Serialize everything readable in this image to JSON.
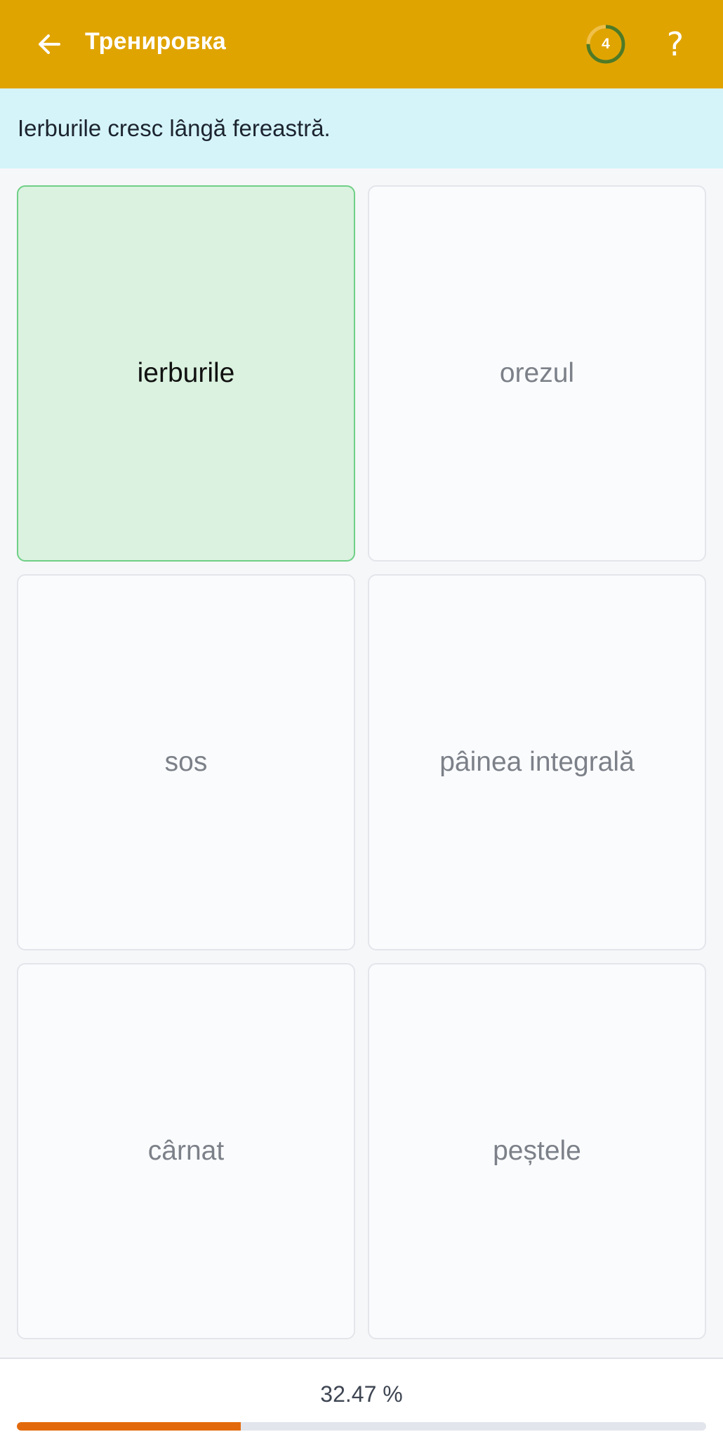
{
  "header": {
    "title": "Тренировка",
    "counter": "4",
    "counter_progress": 0.75,
    "help_label": "?",
    "colors": {
      "background": "#e0a400",
      "ring": "#4f7a26"
    }
  },
  "prompt": {
    "text": "Ierburile cresc lângă fereastră."
  },
  "options": [
    {
      "label": "ierburile",
      "selected": true
    },
    {
      "label": "orezul",
      "selected": false
    },
    {
      "label": "sos",
      "selected": false
    },
    {
      "label": "pâinea integrală",
      "selected": false
    },
    {
      "label": "cârnat",
      "selected": false
    },
    {
      "label": "peștele",
      "selected": false
    }
  ],
  "footer": {
    "progress_text": "32.47 %",
    "progress_value": 0.3247,
    "progress_color": "#e36a0c"
  }
}
